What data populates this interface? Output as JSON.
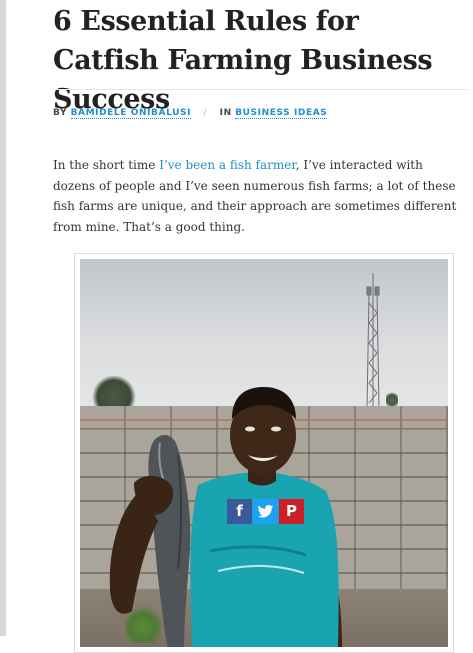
{
  "article": {
    "title": "6 Essential Rules for Catfish Farming Business Success",
    "meta": {
      "by_label": "BY",
      "author": "BAMIDELE ONIBALUSI",
      "separator": "/",
      "in_label": "IN",
      "category": "BUSINESS IDEAS"
    },
    "intro": {
      "before_link": "In the short time ",
      "link_text": "I’ve been a fish farmer",
      "after_link": ", I’ve interacted with dozens of people and I’ve seen numerous fish farms; a lot of these fish farms are unique, and their approach are sometimes different from mine. That’s a good thing."
    }
  },
  "share_buttons": [
    {
      "label": "f",
      "icon": "facebook-icon",
      "color": "#3b5998"
    },
    {
      "label": "t",
      "icon": "twitter-icon",
      "color": "#1da1f2"
    },
    {
      "label": "P",
      "icon": "pinterest-icon",
      "color": "#cb2027"
    }
  ],
  "colors": {
    "link": "#1e8fc9",
    "title": "#222222",
    "body_text": "#333333"
  }
}
